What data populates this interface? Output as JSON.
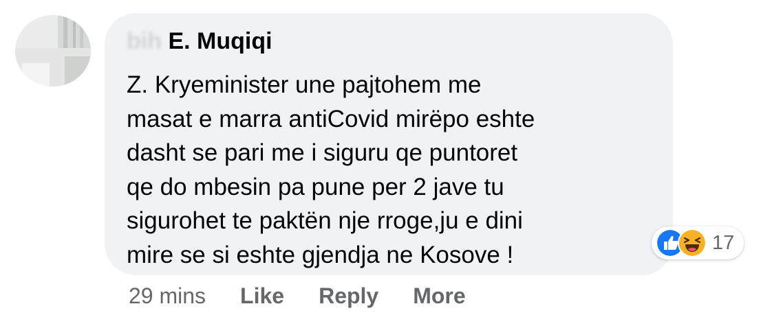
{
  "comment": {
    "author_obscured": "bih",
    "author_visible": "E. Muqiqi",
    "text": "Z. Kryeminister une pajtohem me\nmasat e marra antiCovid mirëpo eshte\ndasht se pari me i siguru qe puntoret\nqe do mbesin pa pune per 2 jave tu\nsigurohet te paktën nje rroge,ju e dini\nmire se si eshte gjendja ne Kosove !",
    "reactions": {
      "icons": [
        "like-icon",
        "haha-icon"
      ],
      "count": "17"
    },
    "time": "29 mins",
    "actions": {
      "like": "Like",
      "reply": "Reply",
      "more": "More"
    }
  },
  "colors": {
    "bubble": "#f0f2f5",
    "secondary_text": "#65676b",
    "like_blue": "#1877f2",
    "haha_yellow": "#f7b125"
  }
}
